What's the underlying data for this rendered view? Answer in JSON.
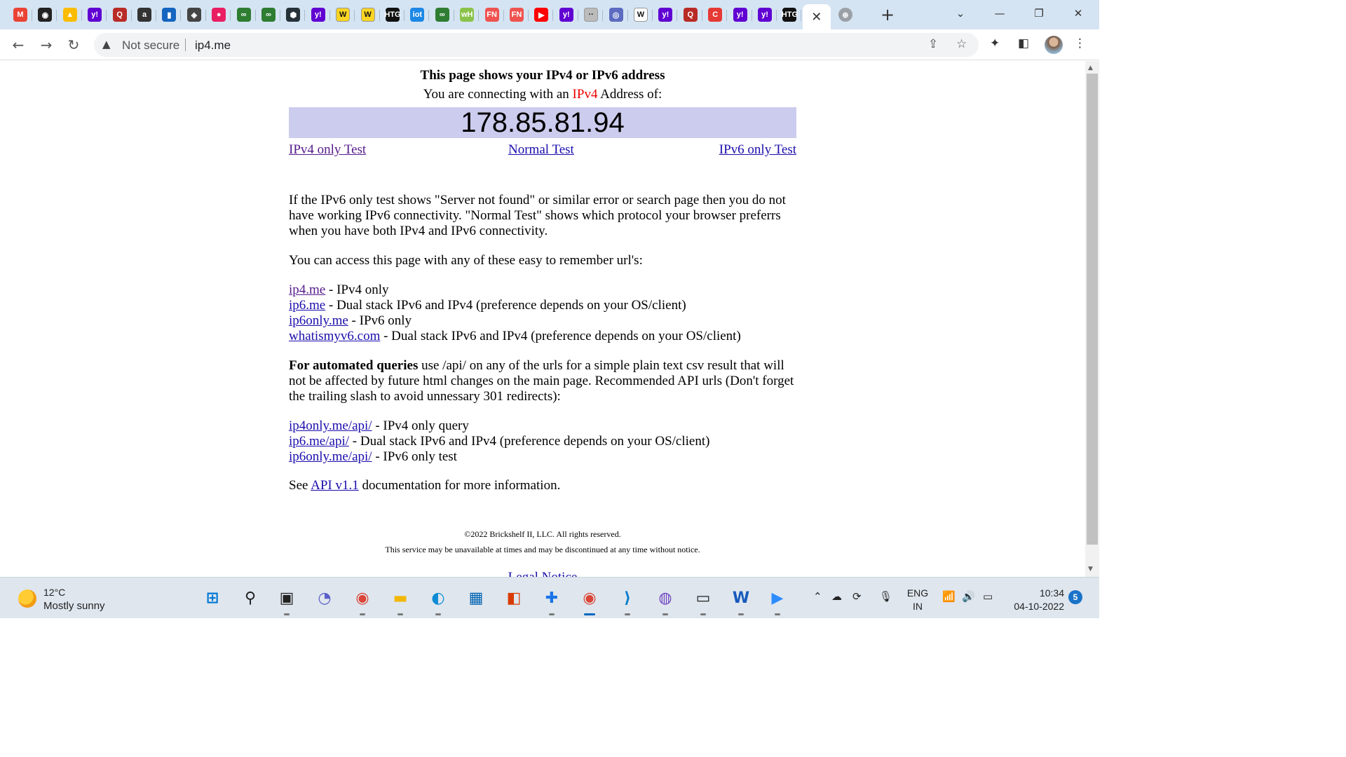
{
  "browser": {
    "tabs": [
      {
        "icon": "gmail-icon",
        "glyph": "M",
        "color": "#ea4335"
      },
      {
        "icon": "github-icon",
        "glyph": "◉",
        "color": "#222222"
      },
      {
        "icon": "drive-icon",
        "glyph": "▲",
        "color": "#fbbc04"
      },
      {
        "icon": "yahoo-icon",
        "glyph": "y!",
        "color": "#6001d2"
      },
      {
        "icon": "quora-icon",
        "glyph": "Q",
        "color": "#b92b27"
      },
      {
        "icon": "site-icon",
        "glyph": "a",
        "color": "#333333"
      },
      {
        "icon": "bookmark-site-icon",
        "glyph": "▮",
        "color": "#1565c0"
      },
      {
        "icon": "diamond-site-icon",
        "glyph": "◈",
        "color": "#444444"
      },
      {
        "icon": "pink-site-icon",
        "glyph": "●",
        "color": "#e91e63"
      },
      {
        "icon": "green-site-icon",
        "glyph": "∞",
        "color": "#2e7d32"
      },
      {
        "icon": "green-site-icon",
        "glyph": "∞",
        "color": "#2e7d32"
      },
      {
        "icon": "hex-site-icon",
        "glyph": "⬢",
        "color": "#263238"
      },
      {
        "icon": "yahoo-icon",
        "glyph": "y!",
        "color": "#6001d2"
      },
      {
        "icon": "wordle-icon",
        "glyph": "W",
        "color": "#f9d423"
      },
      {
        "icon": "wordle-icon",
        "glyph": "W",
        "color": "#f9d423"
      },
      {
        "icon": "htg-icon",
        "glyph": "HTG",
        "color": "#111111"
      },
      {
        "icon": "iot-icon",
        "glyph": "iot",
        "color": "#1e88e5"
      },
      {
        "icon": "green-site-icon",
        "glyph": "∞",
        "color": "#2e7d32"
      },
      {
        "icon": "round-site-icon",
        "glyph": "wH",
        "color": "#8bc34a"
      },
      {
        "icon": "fn-icon",
        "glyph": "FN",
        "color": "#ef5350"
      },
      {
        "icon": "fn-icon",
        "glyph": "FN",
        "color": "#ef5350"
      },
      {
        "icon": "youtube-icon",
        "glyph": "▶",
        "color": "#ff0000"
      },
      {
        "icon": "yahoo-icon",
        "glyph": "y!",
        "color": "#6001d2"
      },
      {
        "icon": "faded-site-icon",
        "glyph": "··",
        "color": "#bbbbbb"
      },
      {
        "icon": "emblem-icon",
        "glyph": "◎",
        "color": "#5c6bc0"
      },
      {
        "icon": "wikipedia-icon",
        "glyph": "W",
        "color": "#ffffff"
      },
      {
        "icon": "yahoo-icon",
        "glyph": "y!",
        "color": "#6001d2"
      },
      {
        "icon": "quora-icon",
        "glyph": "Q",
        "color": "#b92b27"
      },
      {
        "icon": "c-site-icon",
        "glyph": "C",
        "color": "#e53935"
      },
      {
        "icon": "yahoo-icon",
        "glyph": "y!",
        "color": "#6001d2"
      },
      {
        "icon": "yahoo-icon",
        "glyph": "y!",
        "color": "#6001d2"
      },
      {
        "icon": "htg-icon",
        "glyph": "HTG",
        "color": "#111111"
      }
    ],
    "active_tab_close": "✕",
    "extra_tab_icon": "globe-icon",
    "new_tab": "+",
    "address": {
      "security_label": "Not secure",
      "url": "ip4.me"
    }
  },
  "content": {
    "headline": "This page shows your IPv4 or IPv6 address",
    "connecting_prefix": "You are connecting with an ",
    "connecting_protocol": "IPv4",
    "connecting_suffix": " Address of:",
    "ip_address": "178.85.81.94",
    "test_links": {
      "ipv4": "IPv4 only Test",
      "normal": "Normal Test",
      "ipv6": "IPv6 only Test"
    },
    "para1": "If the IPv6 only test shows \"Server not found\" or similar error or search page then you do not have working IPv6 connectivity. \"Normal Test\" shows which protocol your browser preferrs when you have both IPv4 and IPv6 connectivity.",
    "para2": "You can access this page with any of these easy to remember url's:",
    "urls": [
      {
        "link": "ip4.me",
        "desc": " - IPv4 only",
        "visited": true
      },
      {
        "link": "ip6.me",
        "desc": " - Dual stack IPv6 and IPv4 (preference depends on your OS/client)",
        "visited": false
      },
      {
        "link": "ip6only.me",
        "desc": " - IPv6 only",
        "visited": false
      },
      {
        "link": "whatismyv6.com",
        "desc": " - Dual stack IPv6 and IPv4 (preference depends on your OS/client)",
        "visited": false
      }
    ],
    "api_bold": "For automated queries",
    "api_text": " use /api/ on any of the urls for a simple plain text csv result that will not be affected by future html changes on the main page. Recommended API urls (Don't forget the trailing slash to avoid unnessary 301 redirects):",
    "api_urls": [
      {
        "link": "ip4only.me/api/",
        "desc": " - IPv4 only query"
      },
      {
        "link": "ip6.me/api/",
        "desc": " - Dual stack IPv6 and IPv4 (preference depends on your OS/client)"
      },
      {
        "link": "ip6only.me/api/",
        "desc": " - IPv6 only test"
      }
    ],
    "see_prefix": "See ",
    "see_link": "API v1.1",
    "see_suffix": " documentation for more information.",
    "copyright": "©2022 Brickshelf II, LLC. All rights reserved.",
    "disclaimer": "This service may be unavailable at times and may be discontinued at any time without notice.",
    "legal": "Legal Notice"
  },
  "taskbar": {
    "weather_temp": "12°C",
    "weather_desc": "Mostly sunny",
    "apps": [
      {
        "name": "start-icon",
        "color": "#0078d4"
      },
      {
        "name": "search-icon",
        "color": "#222222"
      },
      {
        "name": "task-view-icon",
        "color": "#222222"
      },
      {
        "name": "chat-icon",
        "color": "#5b5fc7"
      },
      {
        "name": "chrome-icon",
        "color": "#db4437"
      },
      {
        "name": "file-explorer-icon",
        "color": "#f2b705"
      },
      {
        "name": "edge-icon",
        "color": "#0c8bd6"
      },
      {
        "name": "store-icon",
        "color": "#0063b1"
      },
      {
        "name": "office-icon",
        "color": "#d83b01"
      },
      {
        "name": "app-icon",
        "color": "#1a73e8"
      },
      {
        "name": "chrome-profile-icon",
        "color": "#db4437"
      },
      {
        "name": "vscode-icon",
        "color": "#007acc"
      },
      {
        "name": "github-desktop-icon",
        "color": "#6f42c1"
      },
      {
        "name": "terminal-icon",
        "color": "#222222"
      },
      {
        "name": "word-icon",
        "color": "#185abd"
      },
      {
        "name": "zoom-icon",
        "color": "#2d8cff"
      }
    ],
    "lang_top": "ENG",
    "lang_bottom": "IN",
    "time": "10:34",
    "date": "04-10-2022",
    "notification_count": "5"
  }
}
